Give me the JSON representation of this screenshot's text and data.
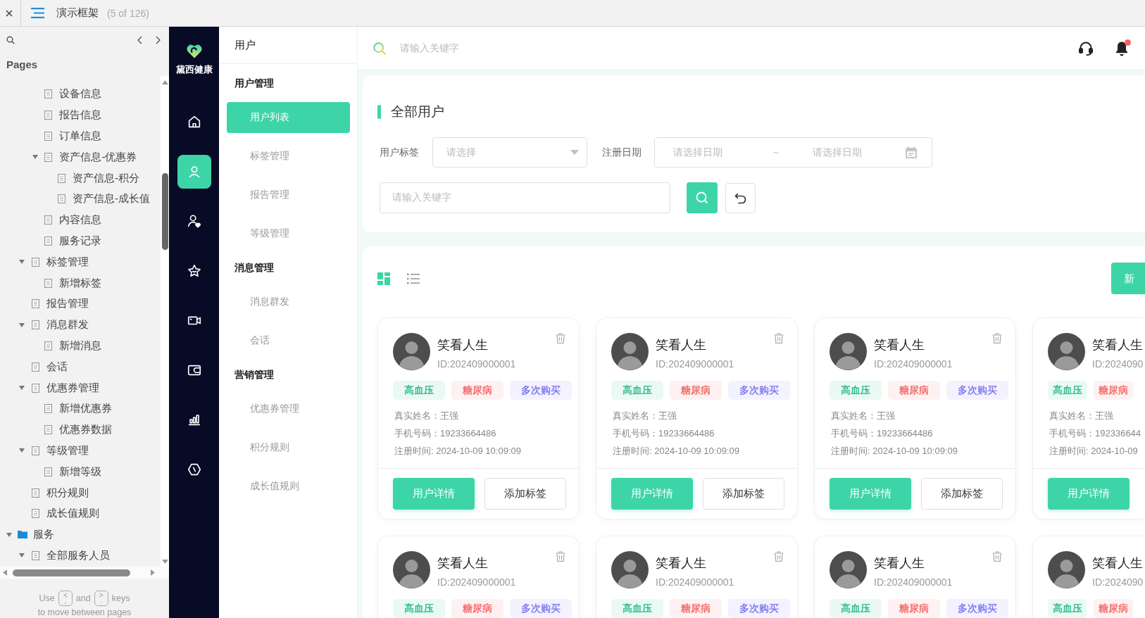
{
  "topbar": {
    "title": "演示框架",
    "count": "(5 of 126)"
  },
  "pages_panel": {
    "heading": "Pages",
    "tree": [
      {
        "children": [
          {
            "children": [
              {
                "label": "设备信息",
                "kind": "page"
              },
              {
                "label": "报告信息",
                "kind": "page"
              },
              {
                "label": "订单信息",
                "kind": "page"
              },
              {
                "label": "资产信息-优惠券",
                "kind": "page",
                "expanded": true,
                "children": [
                  {
                    "label": "资产信息-积分",
                    "kind": "page"
                  },
                  {
                    "label": "资产信息-成长值",
                    "kind": "page"
                  }
                ]
              },
              {
                "label": "内容信息",
                "kind": "page"
              },
              {
                "label": "服务记录",
                "kind": "page"
              }
            ]
          },
          {
            "label": "标签管理",
            "kind": "page",
            "expanded": true,
            "children": [
              {
                "label": "新增标签",
                "kind": "page"
              }
            ]
          },
          {
            "label": "报告管理",
            "kind": "page"
          },
          {
            "label": "消息群发",
            "kind": "page",
            "expanded": true,
            "children": [
              {
                "label": "新增消息",
                "kind": "page"
              }
            ]
          },
          {
            "label": "会话",
            "kind": "page"
          },
          {
            "label": "优惠券管理",
            "kind": "page",
            "expanded": true,
            "children": [
              {
                "label": "新增优惠券",
                "kind": "page"
              },
              {
                "label": "优惠券数据",
                "kind": "page"
              }
            ]
          },
          {
            "label": "等级管理",
            "kind": "page",
            "expanded": true,
            "children": [
              {
                "label": "新增等级",
                "kind": "page"
              }
            ]
          },
          {
            "label": "积分规则",
            "kind": "page"
          },
          {
            "label": "成长值规则",
            "kind": "page"
          }
        ]
      },
      {
        "label": "服务",
        "kind": "folder",
        "expanded": true,
        "children": [
          {
            "label": "全部服务人员",
            "kind": "page",
            "expanded": true
          }
        ]
      }
    ],
    "footer": {
      "line1": [
        {
          "kind": "text",
          "text": "Use"
        },
        {
          "kind": "key",
          "upper": "<",
          "lower": ","
        },
        {
          "kind": "text",
          "text": "and"
        },
        {
          "kind": "key",
          "upper": ">",
          "lower": "."
        },
        {
          "kind": "text",
          "text": "keys"
        }
      ],
      "line2": "to move between pages"
    }
  },
  "sidebar": {
    "brand": "黛西健康",
    "nav": [
      {
        "selected": false
      },
      {
        "selected": true
      },
      {
        "selected": false
      },
      {
        "selected": false
      },
      {
        "selected": false
      },
      {
        "selected": false
      },
      {
        "selected": false
      },
      {
        "selected": false
      }
    ]
  },
  "submenu": {
    "title": "用户",
    "groups": [
      {
        "label": "用户管理",
        "items": [
          {
            "label": "用户列表",
            "selected": true
          },
          {
            "label": "标签管理",
            "selected": false
          },
          {
            "label": "报告管理",
            "selected": false
          },
          {
            "label": "等级管理",
            "selected": false
          }
        ]
      },
      {
        "label": "消息管理",
        "items": [
          {
            "label": "消息群发",
            "selected": false
          },
          {
            "label": "会话",
            "selected": false
          }
        ]
      },
      {
        "label": "营销管理",
        "items": [
          {
            "label": "优惠券管理",
            "selected": false
          },
          {
            "label": "积分规则",
            "selected": false
          },
          {
            "label": "成长值规则",
            "selected": false
          }
        ]
      }
    ]
  },
  "header": {
    "search_placeholder": "请输入关键字",
    "unread": true
  },
  "filter": {
    "title": "全部用户",
    "tag_label": "用户标签",
    "tag_placeholder": "请选择",
    "date_label": "注册日期",
    "date_start_placeholder": "请选择日期",
    "date_separator": "~",
    "date_end_placeholder": "请选择日期",
    "keyword_placeholder": "请输入关键字"
  },
  "list": {
    "views": [
      {
        "selected": true
      },
      {
        "selected": false
      }
    ],
    "add_button": "新",
    "cards": [
      {
        "name": "笑看人生",
        "id": "ID:202409000001",
        "show_delete": true,
        "tags": [
          {
            "text": "高血压",
            "color": "#22b982"
          },
          {
            "text": "糖尿病",
            "color": "#f26464"
          },
          {
            "text": "多次购买",
            "color": "#7672f0"
          }
        ],
        "info": [
          "真实姓名：王强",
          "手机号码：19233664486",
          "注册时间: 2024-10-09 10:09:09"
        ],
        "buttons": [
          {
            "label": "用户详情",
            "kind": "primary"
          },
          {
            "label": "添加标签",
            "kind": "outline"
          }
        ]
      },
      {
        "name": "笑看人生",
        "id": "ID:202409000001",
        "show_delete": true,
        "tags": [
          {
            "text": "高血压",
            "color": "#22b982"
          },
          {
            "text": "糖尿病",
            "color": "#f26464"
          },
          {
            "text": "多次购买",
            "color": "#7672f0"
          }
        ],
        "info": [
          "真实姓名：王强",
          "手机号码：19233664486",
          "注册时间: 2024-10-09 10:09:09"
        ],
        "buttons": [
          {
            "label": "用户详情",
            "kind": "primary"
          },
          {
            "label": "添加标签",
            "kind": "outline"
          }
        ]
      },
      {
        "name": "笑看人生",
        "id": "ID:202409000001",
        "show_delete": true,
        "tags": [
          {
            "text": "高血压",
            "color": "#22b982"
          },
          {
            "text": "糖尿病",
            "color": "#f26464"
          },
          {
            "text": "多次购买",
            "color": "#7672f0"
          }
        ],
        "info": [
          "真实姓名：王强",
          "手机号码：19233664486",
          "注册时间: 2024-10-09 10:09:09"
        ],
        "buttons": [
          {
            "label": "用户详情",
            "kind": "primary"
          },
          {
            "label": "添加标签",
            "kind": "outline"
          }
        ]
      },
      {
        "name": "笑看人生",
        "id": "ID:2024090",
        "show_delete": false,
        "tags": [
          {
            "text": "高血压",
            "color": "#22b982"
          },
          {
            "text": "糖尿病",
            "color": "#f26464"
          }
        ],
        "info": [
          "真实姓名：王强",
          "手机号码：192336644",
          "注册时间: 2024-10-09"
        ],
        "buttons": [
          {
            "label": "用户详情",
            "kind": "primary"
          }
        ]
      },
      {
        "name": "笑看人生",
        "id": "ID:202409000001",
        "show_delete": true,
        "tags": [
          {
            "text": "高血压",
            "color": "#22b982"
          },
          {
            "text": "糖尿病",
            "color": "#f26464"
          },
          {
            "text": "多次购买",
            "color": "#7672f0"
          }
        ]
      },
      {
        "name": "笑看人生",
        "id": "ID:202409000001",
        "show_delete": true,
        "tags": [
          {
            "text": "高血压",
            "color": "#22b982"
          },
          {
            "text": "糖尿病",
            "color": "#f26464"
          },
          {
            "text": "多次购买",
            "color": "#7672f0"
          }
        ]
      },
      {
        "name": "笑看人生",
        "id": "ID:202409000001",
        "show_delete": true,
        "tags": [
          {
            "text": "高血压",
            "color": "#22b982"
          },
          {
            "text": "糖尿病",
            "color": "#f26464"
          },
          {
            "text": "多次购买",
            "color": "#7672f0"
          }
        ]
      },
      {
        "name": "笑看人生",
        "id": "ID:2024090",
        "show_delete": false,
        "tags": [
          {
            "text": "高血压",
            "color": "#22b982"
          },
          {
            "text": "糖尿病",
            "color": "#f26464"
          }
        ]
      }
    ]
  }
}
